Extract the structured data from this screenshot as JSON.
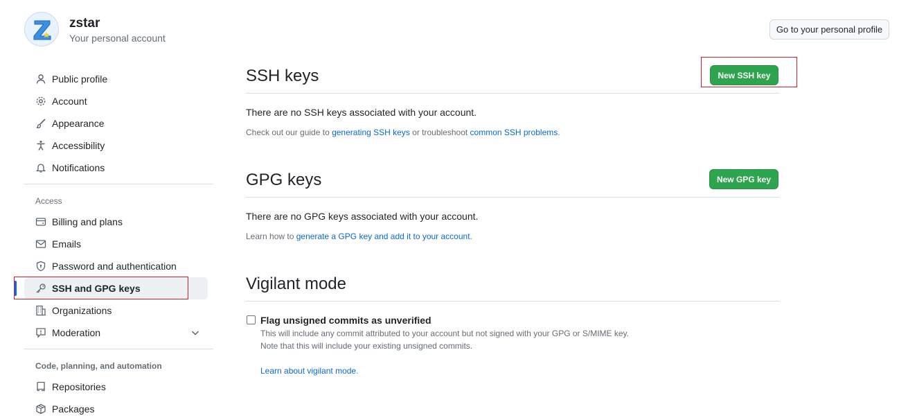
{
  "account": {
    "username": "zstar",
    "subtitle": "Your personal account",
    "profile_button": "Go to your personal profile"
  },
  "sidebar": {
    "items_top": [
      {
        "label": "Public profile",
        "icon": "person-icon"
      },
      {
        "label": "Account",
        "icon": "gear-icon"
      },
      {
        "label": "Appearance",
        "icon": "paintbrush-icon"
      },
      {
        "label": "Accessibility",
        "icon": "accessibility-icon"
      },
      {
        "label": "Notifications",
        "icon": "bell-icon"
      }
    ],
    "access_label": "Access",
    "items_access": [
      {
        "label": "Billing and plans",
        "icon": "credit-card-icon"
      },
      {
        "label": "Emails",
        "icon": "mail-icon"
      },
      {
        "label": "Password and authentication",
        "icon": "shield-lock-icon"
      },
      {
        "label": "SSH and GPG keys",
        "icon": "key-icon",
        "active": true
      },
      {
        "label": "Organizations",
        "icon": "organization-icon"
      },
      {
        "label": "Moderation",
        "icon": "report-icon"
      }
    ],
    "code_label": "Code, planning, and automation",
    "items_code": [
      {
        "label": "Repositories",
        "icon": "repo-icon"
      },
      {
        "label": "Packages",
        "icon": "package-icon"
      }
    ]
  },
  "ssh": {
    "title": "SSH keys",
    "new_button": "New SSH key",
    "empty_text": "There are no SSH keys associated with your account.",
    "guide_prefix": "Check out our guide to ",
    "guide_link": "generating SSH keys",
    "guide_middle": " or troubleshoot ",
    "troubleshoot_link": "common SSH problems",
    "guide_suffix": "."
  },
  "gpg": {
    "title": "GPG keys",
    "new_button": "New GPG key",
    "empty_text": "There are no GPG keys associated with your account.",
    "learn_prefix": "Learn how to ",
    "learn_link": "generate a GPG key and add it to your account",
    "learn_suffix": "."
  },
  "vigilant": {
    "title": "Vigilant mode",
    "checkbox_label": "Flag unsigned commits as unverified",
    "checked": false,
    "note_line1": "This will include any commit attributed to your account but not signed with your GPG or S/MIME key.",
    "note_line2": "Note that this will include your existing unsigned commits.",
    "learn_link": "Learn about vigilant mode",
    "learn_suffix": "."
  },
  "colors": {
    "accent": "#0969da",
    "primary_button": "#2da44e",
    "highlight_box": "#d0202a"
  }
}
